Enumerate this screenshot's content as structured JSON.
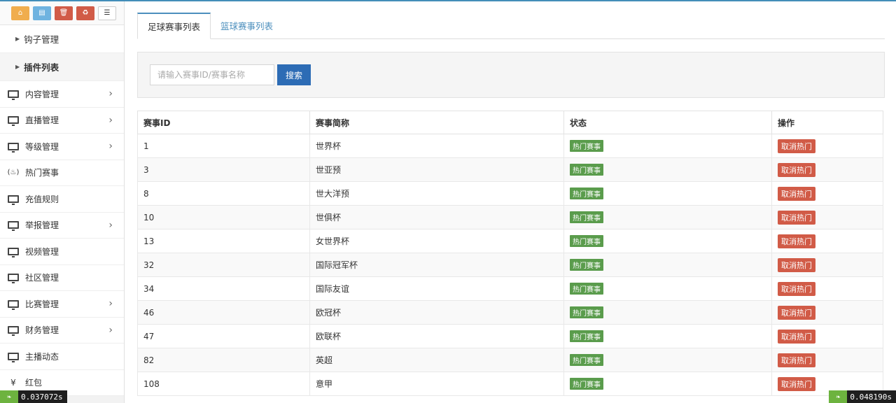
{
  "sidebar": {
    "shortcuts": [
      {
        "icon": "home-icon",
        "glyph": "⌂",
        "color": "#f0ad4e"
      },
      {
        "icon": "document-icon",
        "glyph": "▤",
        "color": "#6fb3e0"
      },
      {
        "icon": "trash-icon",
        "glyph": "🗑",
        "color": "#d15b47"
      },
      {
        "icon": "recycle-icon",
        "glyph": "♻",
        "color": "#d15b47"
      },
      {
        "icon": "list-icon",
        "glyph": "☰",
        "color": "#ffffff"
      }
    ],
    "sub_items": [
      {
        "label": "钩子管理",
        "active": false
      },
      {
        "label": "插件列表",
        "active": true
      }
    ],
    "items": [
      {
        "label": "内容管理",
        "icon": "monitor-icon",
        "has_children": true
      },
      {
        "label": "直播管理",
        "icon": "monitor-icon",
        "has_children": true
      },
      {
        "label": "等级管理",
        "icon": "monitor-icon",
        "has_children": true
      },
      {
        "label": "热门赛事",
        "icon": "fire-icon",
        "has_children": false
      },
      {
        "label": "充值规则",
        "icon": "monitor-icon",
        "has_children": false
      },
      {
        "label": "举报管理",
        "icon": "monitor-icon",
        "has_children": true
      },
      {
        "label": "视频管理",
        "icon": "monitor-icon",
        "has_children": false
      },
      {
        "label": "社区管理",
        "icon": "monitor-icon",
        "has_children": false
      },
      {
        "label": "比赛管理",
        "icon": "monitor-icon",
        "has_children": true
      },
      {
        "label": "财务管理",
        "icon": "monitor-icon",
        "has_children": true
      },
      {
        "label": "主播动态",
        "icon": "monitor-icon",
        "has_children": false
      },
      {
        "label": "红包",
        "icon": "yen-icon",
        "has_children": false
      }
    ]
  },
  "tabs": [
    {
      "label": "足球赛事列表",
      "active": true
    },
    {
      "label": "篮球赛事列表",
      "active": false
    }
  ],
  "search": {
    "placeholder": "请输入赛事ID/赛事名称",
    "button_label": "搜索"
  },
  "table": {
    "headers": [
      "赛事ID",
      "赛事简称",
      "状态",
      "操作"
    ],
    "rows": [
      {
        "id": "1",
        "name": "世界杯",
        "status": "热门赛事",
        "action": "取消热门"
      },
      {
        "id": "3",
        "name": "世亚预",
        "status": "热门赛事",
        "action": "取消热门"
      },
      {
        "id": "8",
        "name": "世大洋预",
        "status": "热门赛事",
        "action": "取消热门"
      },
      {
        "id": "10",
        "name": "世俱杯",
        "status": "热门赛事",
        "action": "取消热门"
      },
      {
        "id": "13",
        "name": "女世界杯",
        "status": "热门赛事",
        "action": "取消热门"
      },
      {
        "id": "32",
        "name": "国际冠军杯",
        "status": "热门赛事",
        "action": "取消热门"
      },
      {
        "id": "34",
        "name": "国际友谊",
        "status": "热门赛事",
        "action": "取消热门"
      },
      {
        "id": "46",
        "name": "欧冠杯",
        "status": "热门赛事",
        "action": "取消热门"
      },
      {
        "id": "47",
        "name": "欧联杯",
        "status": "热门赛事",
        "action": "取消热门"
      },
      {
        "id": "82",
        "name": "英超",
        "status": "热门赛事",
        "action": "取消热门"
      },
      {
        "id": "108",
        "name": "意甲",
        "status": "热门赛事",
        "action": "取消热门"
      }
    ]
  },
  "overlays": {
    "left_timer": "0.037072s",
    "right_timer": "0.048190s"
  },
  "colors": {
    "accent": "#2d6cb5",
    "status_green": "#5a9c4c",
    "danger_red": "#d15b47"
  }
}
